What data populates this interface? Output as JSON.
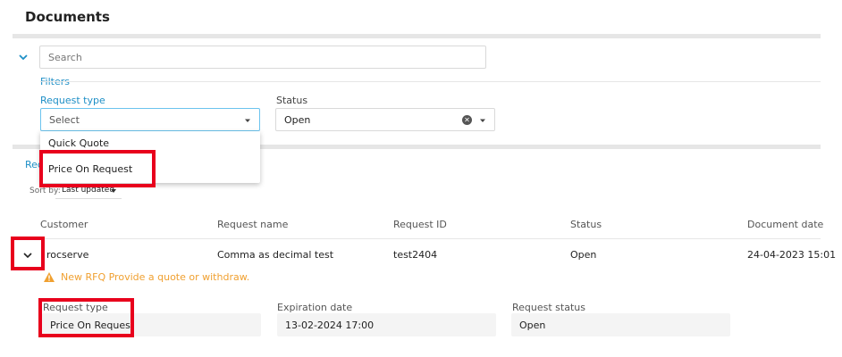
{
  "page": {
    "title": "Documents"
  },
  "search": {
    "placeholder": "Search"
  },
  "filters": {
    "label": "Filters",
    "request_type": {
      "label": "Request type",
      "value": "Select",
      "options": [
        "Quick Quote",
        "Price On Request"
      ]
    },
    "status": {
      "label": "Status",
      "value": "Open"
    }
  },
  "tabs_partial": "Rec",
  "sort": {
    "label": "Sort by:",
    "value": "Last updated"
  },
  "table": {
    "columns": [
      "Customer",
      "Request name",
      "Request ID",
      "Status",
      "Document date"
    ],
    "rows": [
      {
        "customer": "rocserve",
        "request_name": "Comma as decimal test",
        "request_id": "test2404",
        "status": "Open",
        "document_date": "24-04-2023 15:01",
        "notice": "New RFQ Provide a quote or withdraw.",
        "details": {
          "request_type_label": "Request type",
          "request_type_value": "Price On Request",
          "expiration_label": "Expiration date",
          "expiration_value": "13-02-2024 17:00",
          "request_status_label": "Request status",
          "request_status_value": "Open"
        }
      }
    ]
  },
  "colors": {
    "accent": "#1e8fc6",
    "highlight": "#e8001c",
    "warning": "#f0a030",
    "divider": "#e6e6e6"
  },
  "icons": [
    "chevron-down-icon",
    "caret-down-icon",
    "clear-icon",
    "warning-icon"
  ]
}
